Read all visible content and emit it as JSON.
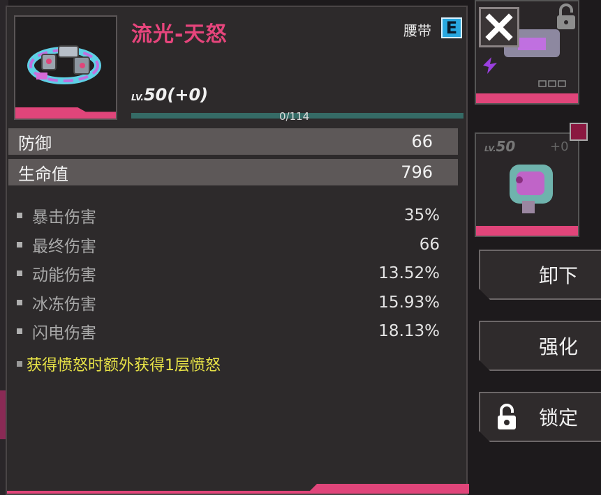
{
  "item": {
    "name": "流光-天怒",
    "slot": "腰带",
    "rarity": "E",
    "level_prefix": "LV.",
    "level": "50(+0)",
    "xp": "0/114",
    "xp_progress": 0
  },
  "main_stats": [
    {
      "name": "防御",
      "value": "66"
    },
    {
      "name": "生命值",
      "value": "796"
    }
  ],
  "sub_stats": [
    {
      "name": "暴击伤害",
      "value": "35%"
    },
    {
      "name": "最终伤害",
      "value": "66"
    },
    {
      "name": "动能伤害",
      "value": "13.52%"
    },
    {
      "name": "冰冻伤害",
      "value": "15.93%"
    },
    {
      "name": "闪电伤害",
      "value": "18.13%"
    }
  ],
  "special_effect": "获得愤怒时额外获得1层愤怒",
  "side_card": {
    "level_prefix": "LV.",
    "level": "50",
    "plus": "+0"
  },
  "buttons": {
    "unequip": "卸下",
    "enhance": "强化",
    "lock": "锁定"
  },
  "colors": {
    "name_pink": "#e6457c",
    "rarity_blue": "#29a8e0",
    "effect_yellow": "#e8e347",
    "accent_pink": "#e0457a"
  },
  "icons": {
    "close": "close-icon",
    "lock": "padlock-icon",
    "item": "belt-item-icon"
  }
}
